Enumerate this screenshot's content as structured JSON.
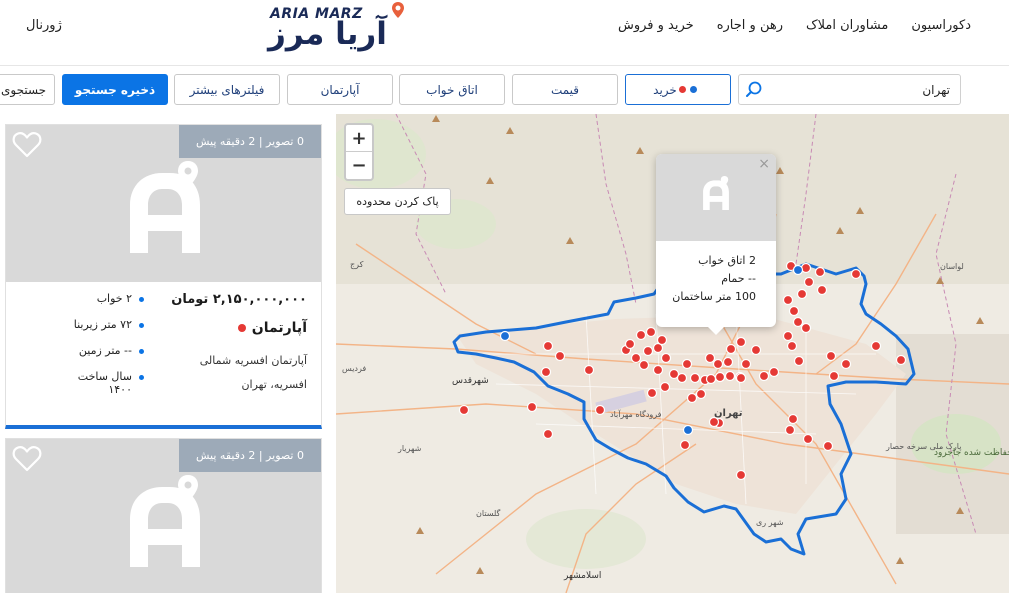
{
  "header": {
    "nav": [
      {
        "label": "خرید و فروش"
      },
      {
        "label": "رهن و اجاره"
      },
      {
        "label": "مشاوران املاک"
      },
      {
        "label": "دکوراسیون"
      }
    ],
    "journal": "ژورنال",
    "logo_en": "ARIA MARZ",
    "logo_fa": "آریا مرز"
  },
  "filters": {
    "search_value": "تهران",
    "buy_label": "خرید",
    "price_label": "قیمت",
    "bedrooms_label": "اتاق خواب",
    "apartment_label": "آپارتمان",
    "more_filters_label": "فیلترهای بیشتر",
    "save_search_label": "ذخیره جستجو",
    "search_cut_label": "جستجوی"
  },
  "listings": [
    {
      "meta": "0 تصویر | 2 دقیقه پیش",
      "price": "۲,۱۵۰,۰۰۰,۰۰۰ تومان",
      "type": "آپارتمان",
      "address_line1": "آپارتمان افسریه شمالی",
      "address_line2": "افسریه، تهران",
      "features": [
        "۲ خواب",
        "۷۲ متر زیربنا",
        "-- متر زمین",
        "سال ساخت ۱۴۰۰"
      ]
    },
    {
      "meta": "0 تصویر | 2 دقیقه پیش"
    }
  ],
  "map": {
    "clear_area_label": "پاک کردن محدوده",
    "zoom_in": "+",
    "zoom_out": "−",
    "popup": {
      "close": "×",
      "line1": "2 اتاق خواب",
      "line2": "-- حمام",
      "line3": "100 متر ساختمان"
    },
    "labels": {
      "tehran": "تهران",
      "karaj": "کرج",
      "shahrqods": "شهرقدس",
      "shahriar": "شهریار",
      "eslamshahr": "اسلامشهر",
      "lavasan": "لواسان",
      "park": "پارک ملی سرخه حصار",
      "protected": "منطقه حفاظت شده جاجرود",
      "airport": "فرودگاه مهرآباد",
      "ferdis": "فردیس",
      "golestan": "گلستان",
      "shahr_rey": "شهر ری"
    },
    "colors": {
      "boundary": "#1a6fd6",
      "marker": "#e53935",
      "marker_blue": "#1a6fd6"
    }
  }
}
